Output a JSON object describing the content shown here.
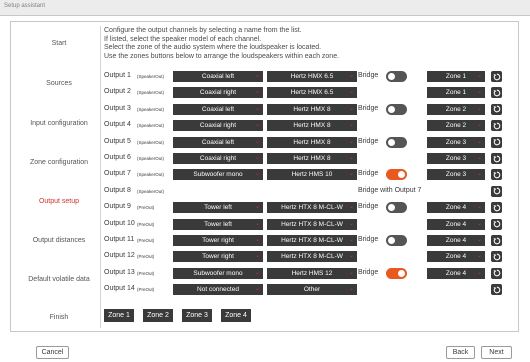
{
  "window": {
    "title": "Setup assistant"
  },
  "sidebar": {
    "items": [
      {
        "label": "Start"
      },
      {
        "label": "Sources"
      },
      {
        "label": "Input configuration"
      },
      {
        "label": "Zone configuration"
      },
      {
        "label": "Output setup",
        "active": true
      },
      {
        "label": "Output distances"
      },
      {
        "label": "Default volatile data"
      },
      {
        "label": "Finish"
      }
    ]
  },
  "instructions": [
    "Configure the output channels by selecting a name from the list.",
    "If listed, select the speaker model of each channel.",
    "Select the zone of the audio system where the loudspeaker is located.",
    "Use the zones buttons below to arrange the loudspeakers within each zone."
  ],
  "bridge_label": "Bridge",
  "outputs": [
    {
      "label": "Output 1",
      "type": "(SpeakerOut)",
      "function": "Coaxial left",
      "model": "Hertz HMX 6.5",
      "bridge_toggle": true,
      "bridge_on": false,
      "zone": "Zone 1"
    },
    {
      "label": "Output 2",
      "type": "(SpeakerOut)",
      "function": "Coaxial right",
      "model": "Hertz HMX 6.5",
      "bridge_toggle": false,
      "zone": "Zone 1"
    },
    {
      "label": "Output 3",
      "type": "(SpeakerOut)",
      "function": "Coaxial left",
      "model": "Hertz HMX 8",
      "bridge_toggle": true,
      "bridge_on": false,
      "zone": "Zone 2"
    },
    {
      "label": "Output 4",
      "type": "(SpeakerOut)",
      "function": "Coaxial right",
      "model": "Hertz HMX 8",
      "bridge_toggle": false,
      "zone": "Zone 2"
    },
    {
      "label": "Output 5",
      "type": "(SpeakerOut)",
      "function": "Coaxial left",
      "model": "Hertz HMX 8",
      "bridge_toggle": true,
      "bridge_on": false,
      "zone": "Zone 3"
    },
    {
      "label": "Output 6",
      "type": "(SpeakerOut)",
      "function": "Coaxial right",
      "model": "Hertz HMX 8",
      "bridge_toggle": false,
      "zone": "Zone 3"
    },
    {
      "label": "Output 7",
      "type": "(SpeakerOut)",
      "function": "Subwoofer mono",
      "model": "Hertz HMS 10",
      "bridge_toggle": true,
      "bridge_on": true,
      "zone": "Zone 3"
    },
    {
      "label": "Output 8",
      "type": "(SpeakerOut)",
      "bridged_note": "Bridge with Output 7"
    },
    {
      "label": "Output 9",
      "type": "(PreOut)",
      "function": "Tower left",
      "model": "Hertz HTX 8 M-CL-W",
      "bridge_toggle": true,
      "bridge_on": false,
      "zone": "Zone 4"
    },
    {
      "label": "Output 10",
      "type": "(PreOut)",
      "function": "Tower left",
      "model": "Hertz HTX 8 M-CL-W",
      "bridge_toggle": false,
      "zone": "Zone 4"
    },
    {
      "label": "Output 11",
      "type": "(PreOut)",
      "function": "Tower right",
      "model": "Hertz HTX 8 M-CL-W",
      "bridge_toggle": true,
      "bridge_on": false,
      "zone": "Zone 4"
    },
    {
      "label": "Output 12",
      "type": "(PreOut)",
      "function": "Tower right",
      "model": "Hertz HTX 8 M-CL-W",
      "bridge_toggle": false,
      "zone": "Zone 4"
    },
    {
      "label": "Output 13",
      "type": "(PreOut)",
      "function": "Subwoofer mono",
      "model": "Hertz HMS 12",
      "bridge_toggle": true,
      "bridge_on": true,
      "zone": "Zone 4"
    },
    {
      "label": "Output 14",
      "type": "(PreOut)",
      "function": "Not connected",
      "model": "Other",
      "bridge_toggle": false,
      "zone": ""
    }
  ],
  "zone_buttons": [
    "Zone 1",
    "Zone 2",
    "Zone 3",
    "Zone 4"
  ],
  "footer": {
    "cancel": "Cancel",
    "back": "Back",
    "next": "Next"
  },
  "colors": {
    "accent": "#e8581f",
    "active_nav": "#d0342c",
    "dropdown_bg": "#3a3a3a"
  }
}
